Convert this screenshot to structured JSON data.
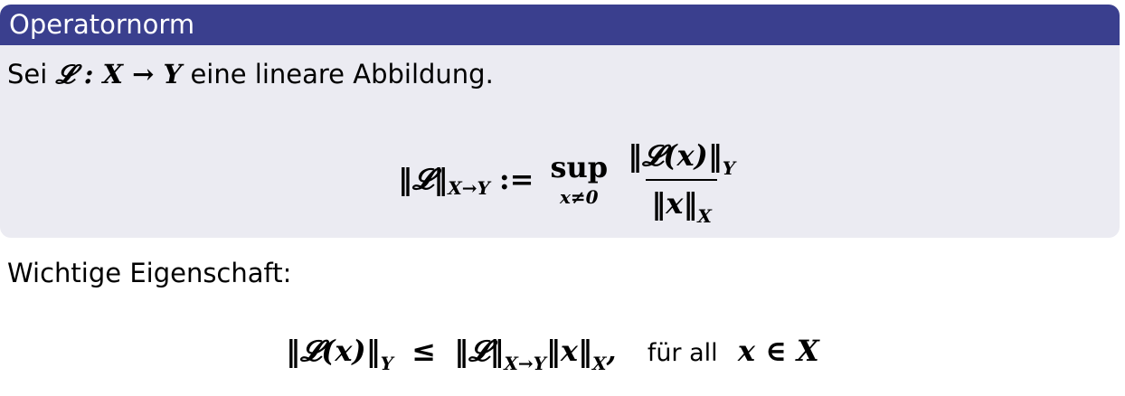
{
  "block": {
    "title": "Operatornorm",
    "intro_prefix": "Sei",
    "intro_map": "𝓛 : X → Y",
    "intro_suffix": "eine lineare Abbildung."
  },
  "formula_norm": {
    "lhs": "‖𝓛‖",
    "lhs_sub": "X→Y",
    "defeq": ":=",
    "sup": "sup",
    "sup_cond": "x≠0",
    "numerator": "‖𝓛(x)‖",
    "numerator_sub": "Y",
    "denominator": "‖x‖",
    "denominator_sub": "X"
  },
  "property": {
    "label": "Wichtige Eigenschaft:",
    "lhs": "‖𝓛(x)‖",
    "lhs_sub": "Y",
    "leq": "≤",
    "rhs_op": "‖𝓛‖",
    "rhs_op_sub": "X→Y",
    "rhs_x": "‖x‖",
    "rhs_x_sub": "X",
    "comma": ",",
    "text": "für all",
    "cond": "x ∈ X"
  }
}
